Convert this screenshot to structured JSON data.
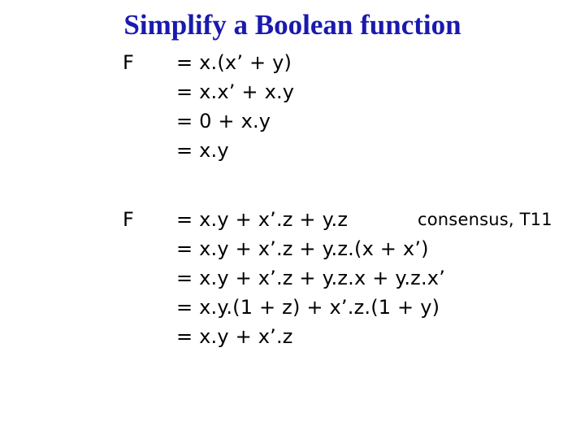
{
  "slide": {
    "title": "Simplify a Boolean function",
    "title_color": "#1a1aae",
    "background_color": "#ffffff",
    "text_color": "#000000"
  },
  "blocks": [
    {
      "label": "F",
      "lines": [
        {
          "equation": "= x.(x’ + y)",
          "note": ""
        },
        {
          "equation": "= x.x’ + x.y",
          "note": ""
        },
        {
          "equation": "= 0 + x.y",
          "note": ""
        },
        {
          "equation": "= x.y",
          "note": ""
        }
      ]
    },
    {
      "label": "F",
      "lines": [
        {
          "equation": "= x.y + x’.z + y.z",
          "note": "consensus, T11"
        },
        {
          "equation": "= x.y + x’.z + y.z.(x + x’)",
          "note": ""
        },
        {
          "equation": "= x.y + x’.z + y.z.x + y.z.x’",
          "note": ""
        },
        {
          "equation": "= x.y.(1 + z) + x’.z.(1 + y)",
          "note": ""
        },
        {
          "equation": "= x.y + x’.z",
          "note": ""
        }
      ]
    }
  ]
}
